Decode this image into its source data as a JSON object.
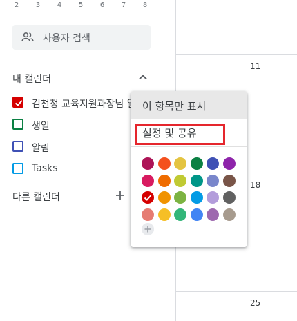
{
  "mini_calendar": {
    "days": [
      "2",
      "3",
      "4",
      "5",
      "6",
      "7",
      "8"
    ]
  },
  "search": {
    "placeholder": "사용자 검색"
  },
  "my_calendars": {
    "title": "내 캘린더",
    "items": [
      {
        "label": "김천청 교육지원과장님 일",
        "color": "#d50000",
        "checked": true
      },
      {
        "label": "생일",
        "color": "#0b8043",
        "checked": false
      },
      {
        "label": "알림",
        "color": "#3f51b5",
        "checked": false
      },
      {
        "label": "Tasks",
        "color": "#039be5",
        "checked": false
      }
    ]
  },
  "other_calendars": {
    "title": "다른 캘린더"
  },
  "calendar_grid": {
    "dates": [
      "11",
      "18",
      "25"
    ]
  },
  "context_menu": {
    "item_display_only": "이 항목만 표시",
    "item_settings_share": "설정 및 공유",
    "selected_color": "#d50000",
    "colors": [
      [
        "#ad1457",
        "#f4511e",
        "#e4c441",
        "#0b8043",
        "#3f51b5",
        "#8e24aa"
      ],
      [
        "#d81b60",
        "#ef6c00",
        "#c0ca33",
        "#009688",
        "#7986cb",
        "#795548"
      ],
      [
        "#d50000",
        "#f09300",
        "#7cb342",
        "#039be5",
        "#b39ddb",
        "#616161"
      ],
      [
        "#e67c73",
        "#f6bf26",
        "#33b679",
        "#4285f4",
        "#9e69af",
        "#a79b8e"
      ]
    ]
  }
}
